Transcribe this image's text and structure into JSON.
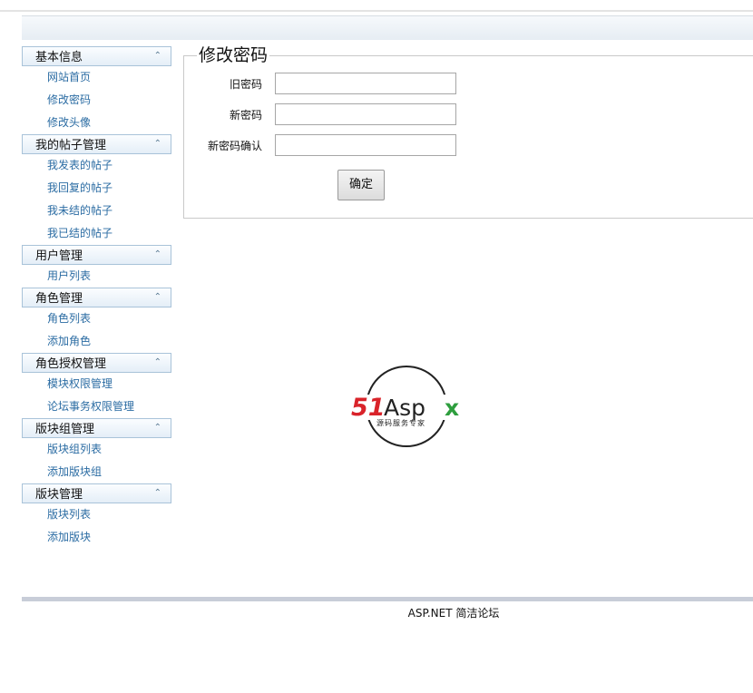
{
  "sidebar": {
    "groups": [
      {
        "title": "基本信息",
        "items": [
          "网站首页",
          "修改密码",
          "修改头像"
        ]
      },
      {
        "title": "我的帖子管理",
        "items": [
          "我发表的帖子",
          "我回复的帖子",
          "我未结的帖子",
          "我已结的帖子"
        ]
      },
      {
        "title": "用户管理",
        "items": [
          "用户列表"
        ]
      },
      {
        "title": "角色管理",
        "items": [
          "角色列表",
          "添加角色"
        ]
      },
      {
        "title": "角色授权管理",
        "items": [
          "模块权限管理",
          "论坛事务权限管理"
        ]
      },
      {
        "title": "版块组管理",
        "items": [
          "版块组列表",
          "添加版块组"
        ]
      },
      {
        "title": "版块管理",
        "items": [
          "版块列表",
          "添加版块"
        ]
      }
    ],
    "collapse_icon": "double-chevron-up-icon"
  },
  "form": {
    "title": "修改密码",
    "fields": [
      {
        "label": "旧密码",
        "value": ""
      },
      {
        "label": "新密码",
        "value": ""
      },
      {
        "label": "新密码确认",
        "value": ""
      }
    ],
    "submit_label": "确定"
  },
  "logo": {
    "text_main_a": "51",
    "text_main_b": "Asp",
    "text_main_c": "x",
    "tagline": "源码服务专家",
    "colors": {
      "red": "#d9232a",
      "dark": "#222222",
      "green": "#2e9e3e"
    }
  },
  "footer": {
    "text": "ASP.NET 简洁论坛"
  }
}
